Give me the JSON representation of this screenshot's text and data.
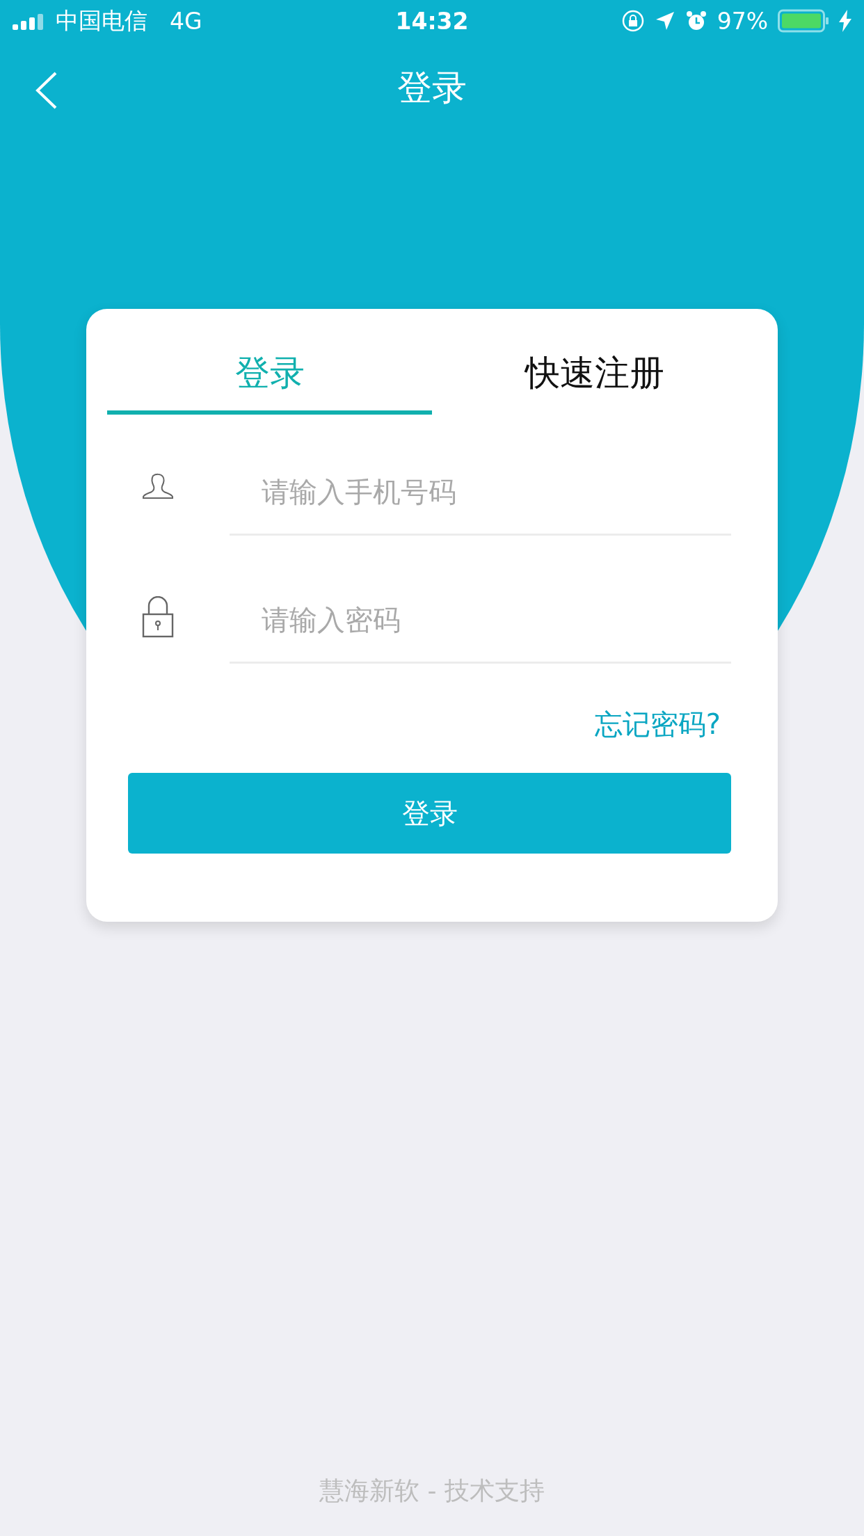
{
  "status_bar": {
    "carrier": "中国电信",
    "network": "4G",
    "time": "14:32",
    "battery": "97%"
  },
  "nav": {
    "title": "登录"
  },
  "tabs": [
    {
      "label": "登录",
      "selected": true
    },
    {
      "label": "快速注册",
      "selected": false
    }
  ],
  "fields": [
    {
      "kind": "phone",
      "placeholder": "请输入手机号码"
    },
    {
      "kind": "password",
      "placeholder": "请输入密码"
    }
  ],
  "forgot_link": "忘记密码?",
  "submit_button": "登录",
  "footer": "慧海新软 - 技术支持"
}
